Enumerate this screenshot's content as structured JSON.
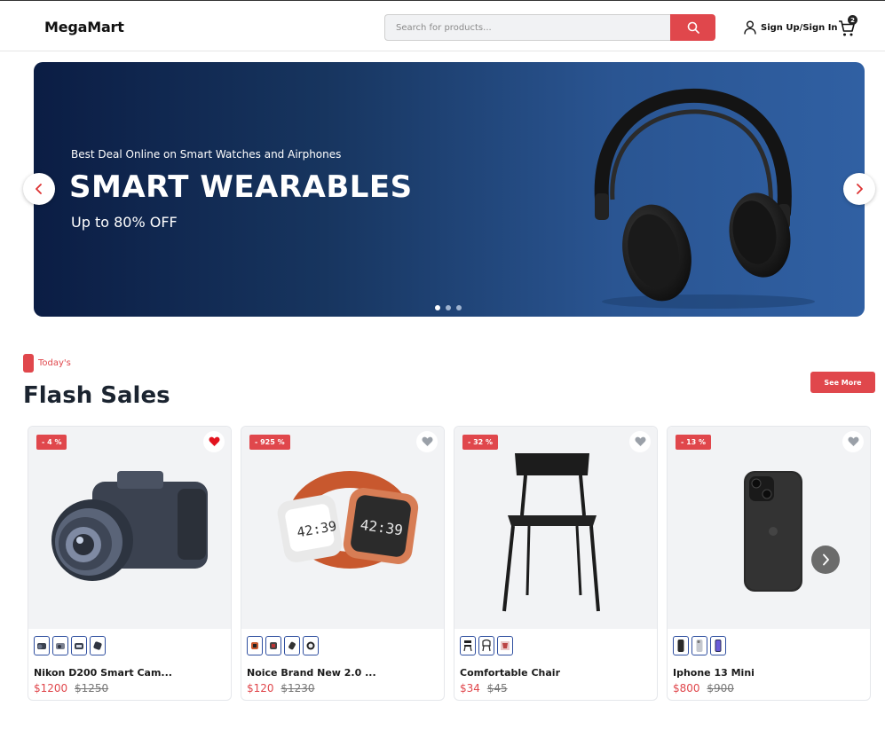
{
  "header": {
    "logo": "MegaMart",
    "search_placeholder": "Search for products...",
    "search_icon": "search-icon",
    "signin_label": "Sign Up/Sign In",
    "user_icon": "user-icon",
    "cart_icon": "cart-icon",
    "cart_count": "2"
  },
  "hero": {
    "kicker": "Best Deal Online on Smart Watches and Airphones",
    "title": "SMART WEARABLES",
    "subtitle": "Up to 80% OFF",
    "image": "headphones-image",
    "slide_count": 3,
    "active_slide": 1
  },
  "section": {
    "tag": "Today's",
    "title": "Flash Sales",
    "see_more": "See More"
  },
  "colors": {
    "accent": "#e0474c",
    "hero_dark": "#0b1d44",
    "hero_light": "#3060a3",
    "thumb_border": "#2f4fa0"
  },
  "products": [
    {
      "discount": "- 4 %",
      "name": "Nikon D200 Smart Cam...",
      "price": "$1200",
      "old_price": "$1250",
      "wishlisted": true,
      "image": "camera-image",
      "thumb_count": 4
    },
    {
      "discount": "- 925 %",
      "name": "Noice Brand New 2.0 ...",
      "price": "$120",
      "old_price": "$1230",
      "wishlisted": false,
      "image": "smartwatch-image",
      "thumb_count": 4
    },
    {
      "discount": "- 32 %",
      "name": "Comfortable Chair",
      "price": "$34",
      "old_price": "$45",
      "wishlisted": false,
      "image": "chair-image",
      "thumb_count": 3
    },
    {
      "discount": "- 13 %",
      "name": "Iphone 13 Mini",
      "price": "$800",
      "old_price": "$900",
      "wishlisted": false,
      "image": "iphone-image",
      "thumb_count": 3
    }
  ]
}
